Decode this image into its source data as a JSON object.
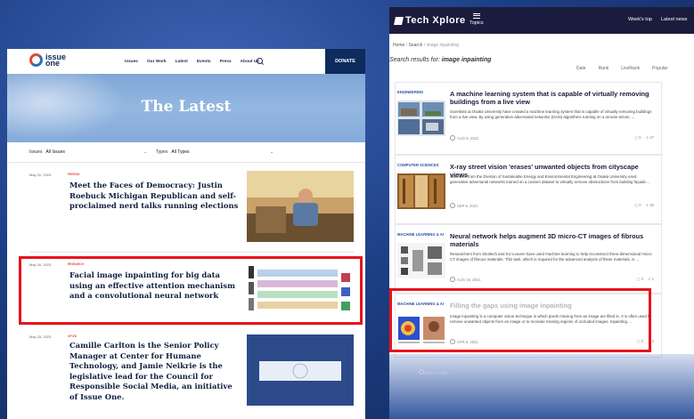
{
  "techxplore": {
    "logo": "Tech Xplore",
    "nav": {
      "topics": "Topics",
      "weeks_top": "Week's top",
      "latest_news": "Latest news"
    },
    "breadcrumb": {
      "home": "Home",
      "search": "Search",
      "current": "image inpainting"
    },
    "search_label": "Search results for:",
    "search_query": "image inpainting",
    "sort_options": [
      "Date",
      "Rank",
      "LiveRank",
      "Popular"
    ],
    "results": [
      {
        "category": "ENGINEERING",
        "title": "A machine learning system that is capable of virtually removing buildings from a live view",
        "description": "Scientists at Osaka University have created a machine learning system that is capable of virtually removing buildings from a live view. By using generative adversarial networks (GAN) algorithms running on a remote server, ...",
        "date": "AUG 5, 2022",
        "comments": "0",
        "shares": "47"
      },
      {
        "category": "COMPUTER SCIENCES",
        "title": "X-ray street vision 'erases' unwanted objects from cityscape views",
        "description": "Scientists from the Division of Sustainable Energy and Environmental Engineering at Osaka University used generative adversarial networks trained on a custom dataset to virtually remove obstructions from building façade ...",
        "date": "SEP 6, 2021",
        "comments": "0",
        "shares": "30"
      },
      {
        "category": "MACHINE LEARNING & AI",
        "title": "Neural network helps augment 3D micro-CT images of fibrous materials",
        "description": "Researchers from Skoltech and KU Leuven have used machine learning to help reconstruct three-dimensional micro-CT images of fibrous materials. This task, which is required for the advanced analysis of these materials, is ...",
        "date": "AUG 16, 2021",
        "comments": "0",
        "shares": "1"
      },
      {
        "category": "MACHINE LEARNING & AI",
        "title": "Filling the gaps using image inpainting",
        "description": "Image inpainting is a computer vision technique in which pixels missing from an image are filled in. It is often used to remove unwanted objects from an image or to recreate missing regions of occluded images. Inpainting ...",
        "date": "APR 8, 2021",
        "comments": "0",
        "shares": "2"
      }
    ],
    "faded_row_date": "MAR 17, 2021"
  },
  "issueone": {
    "logo_word_1": "issue",
    "logo_word_2": "one",
    "nav_items": [
      "Issues",
      "Our Work",
      "Latest",
      "Events",
      "Press",
      "About Us"
    ],
    "donate": "DONATE",
    "hero_title": "The Latest",
    "filter_issues_label": "Issues",
    "filter_issues_value": "All Issues",
    "filter_types_label": "Types",
    "filter_types_value": "All Types",
    "articles": [
      {
        "date": "May 31, 2023",
        "tag": "PERSON",
        "headline": "Meet the Faces of Democracy: Justin Roebuck Michigan Republican and self-proclaimed nerd talks running elections"
      },
      {
        "date": "May 30, 2023",
        "tag": "RESEARCH",
        "headline": "Facial image inpainting for big data using an effective attention mechanism and a convolutional neural network"
      },
      {
        "date": "May 25, 2023",
        "tag": "OP-ED",
        "headline": "Camille Carlton is the Senior Policy Manager at Center for Humane Technology, and Jamie Neikrie is the legislative lead for the Council for Responsible Social Media, an initiative of Issue One."
      }
    ]
  }
}
